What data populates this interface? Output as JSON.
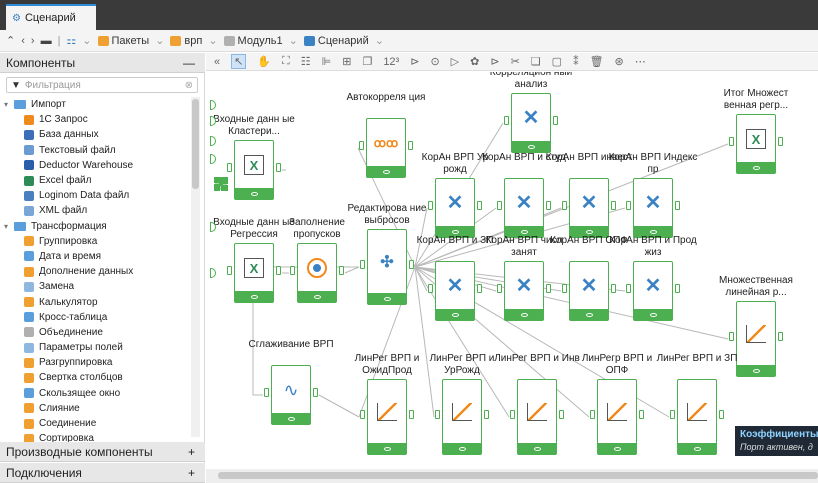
{
  "tab": {
    "title": "Сценарий"
  },
  "nav": {
    "save_icon": "save-icon",
    "breadcrumbs": [
      "Пакеты",
      "врп",
      "Модуль1",
      "Сценарий"
    ]
  },
  "left": {
    "components_title": "Компоненты",
    "components_toggle": "—",
    "filter_placeholder": "Фильтрация",
    "tree": [
      {
        "label": "Импорт",
        "level": 0,
        "folder": true,
        "color": "#5a9fdc"
      },
      {
        "label": "1С Запрос",
        "level": 1,
        "color": "#f08a1d"
      },
      {
        "label": "База данных",
        "level": 1,
        "color": "#3b6db8"
      },
      {
        "label": "Текстовый файл",
        "level": 1,
        "color": "#6c9bd2"
      },
      {
        "label": "Deductor Warehouse",
        "level": 1,
        "color": "#2a5ea8"
      },
      {
        "label": "Excel файл",
        "level": 1,
        "color": "#2e8b57"
      },
      {
        "label": "Loginom Data файл",
        "level": 1,
        "color": "#4a7fc0"
      },
      {
        "label": "XML файл",
        "level": 1,
        "color": "#7aa6d6"
      },
      {
        "label": "Трансформация",
        "level": 0,
        "folder": true,
        "color": "#5a9fdc"
      },
      {
        "label": "Группировка",
        "level": 1,
        "color": "#f0a030"
      },
      {
        "label": "Дата и время",
        "level": 1,
        "color": "#5a9fdc"
      },
      {
        "label": "Дополнение данных",
        "level": 1,
        "color": "#f0a030"
      },
      {
        "label": "Замена",
        "level": 1,
        "color": "#8fb8e0"
      },
      {
        "label": "Калькулятор",
        "level": 1,
        "color": "#f0a030"
      },
      {
        "label": "Кросс-таблица",
        "level": 1,
        "color": "#5a9fdc"
      },
      {
        "label": "Объединение",
        "level": 1,
        "color": "#b0b0b0"
      },
      {
        "label": "Параметры полей",
        "level": 1,
        "color": "#8fb8e0"
      },
      {
        "label": "Разгруппировка",
        "level": 1,
        "color": "#f0a030"
      },
      {
        "label": "Свертка столбцов",
        "level": 1,
        "color": "#f0a030"
      },
      {
        "label": "Скользящее окно",
        "level": 1,
        "color": "#5a9fdc"
      },
      {
        "label": "Слияние",
        "level": 1,
        "color": "#f0a030"
      },
      {
        "label": "Соединение",
        "level": 1,
        "color": "#f0a030"
      },
      {
        "label": "Сортировка",
        "level": 1,
        "color": "#f0a030"
      }
    ],
    "derived_title": "Производные компоненты",
    "derived_plus": "+",
    "connections_title": "Подключения",
    "connections_plus": "+"
  },
  "toolbar": {
    "zoom_text": "12³",
    "icons": [
      "collapse-icon",
      "pointer-icon",
      "hand-icon",
      "fit-icon",
      "grid-icon",
      "align-icon",
      "layout-icon",
      "stack-icon",
      "sum-icon",
      "step-icon",
      "record-icon",
      "run-icon",
      "settings-icon",
      "cursor-icon",
      "cut-icon",
      "copy-icon",
      "paste-icon",
      "columns-icon",
      "delete-icon",
      "link-icon",
      "more-icon"
    ]
  },
  "nodes": {
    "input_cluster": "Входные данн ые Кластери...",
    "autocorr": "Автокорреля ция",
    "corr_analysis": "Корреляцион ный анализ",
    "total_multiple": "Итог Множест венная регр...",
    "korAn_ur_rozhd": "КорАн ВРП Ур рожд",
    "korAn_stud": "КорАн ВРП и студ",
    "korAn_invest": "КорАн ВРП инвест",
    "korAn_index": "КорАн ВРП Индекс пр",
    "input_regress": "Входные данн ые Регрессия",
    "fill_gaps": "Заполнение пропусков",
    "outliers": "Редактирова ние выбросов",
    "korAn_zp": "КорАн ВРП и ЗП",
    "korAn_chisl": "КорАн ВРП числ занят",
    "korAn_opf": "КорАн ВРП ОПФ",
    "korAn_prod": "КорАн ВРП и Прод жиз",
    "multiple_linear": "Множественная линейная р...",
    "smoothing": "Сглаживание ВРП",
    "linreg_ozhid": "ЛинРег ВРП и ОжидПрод",
    "linreg_ur": "ЛинРег ВРП и УрРожд",
    "linreg_inv": "ЛинРег ВРП и Инв",
    "linreg_opf": "ЛинРегр ВРП и ОПФ",
    "linreg_zp": "ЛинРег ВРП и ЗП"
  },
  "tooltip": {
    "title": "Коэффициенты р",
    "subtitle": "Порт активен, д"
  },
  "colors": {
    "accent": "#4caf50",
    "tab_accent": "#2f8bd8",
    "orange": "#f08a1d",
    "blue": "#3b82c4"
  }
}
